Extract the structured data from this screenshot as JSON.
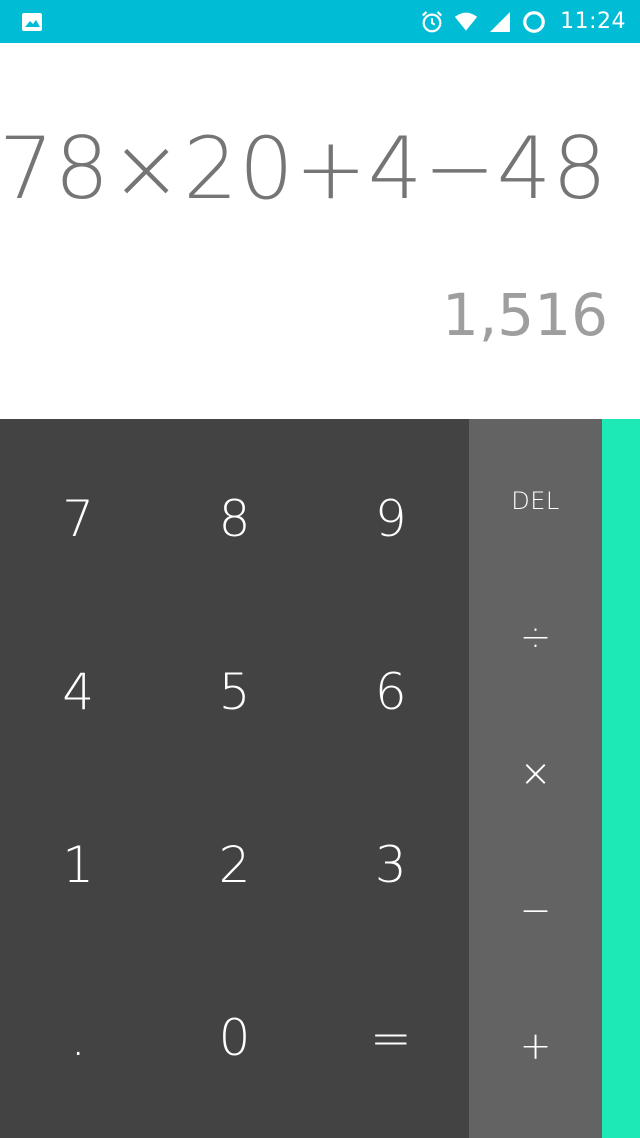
{
  "status_bar": {
    "time": "11:24",
    "icons": [
      "image-icon",
      "alarm-icon",
      "wifi-icon",
      "signal-icon",
      "battery-icon"
    ],
    "color": "#00BCD4"
  },
  "display": {
    "formula": "78×20+4−48",
    "result": "1,516"
  },
  "numpad": {
    "keys": [
      "7",
      "8",
      "9",
      "4",
      "5",
      "6",
      "1",
      "2",
      "3",
      ".",
      "0",
      "="
    ],
    "color": "#434343"
  },
  "operators": {
    "keys": [
      "DEL",
      "÷",
      "×",
      "−",
      "+"
    ],
    "color": "#636363"
  },
  "accent_color": "#1DE9B6"
}
